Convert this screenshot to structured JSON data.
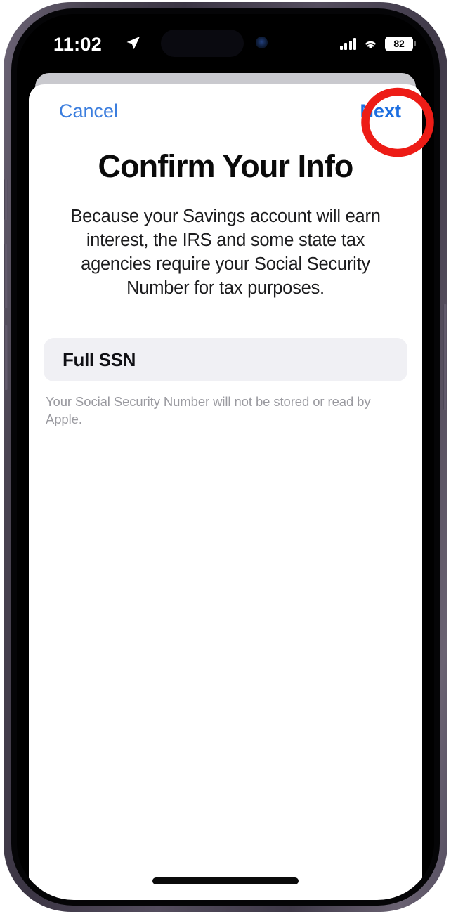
{
  "status_bar": {
    "time": "11:02",
    "location_arrow_icon": "location-arrow-icon",
    "signal_icon": "signal-bars-icon",
    "wifi_icon": "wifi-icon",
    "battery_level": "82"
  },
  "nav_bar": {
    "cancel_label": "Cancel",
    "next_label": "Next"
  },
  "screen": {
    "title": "Confirm Your Info",
    "description": "Because your Savings account will earn interest, the IRS and some state tax agencies require your Social Security Number for tax purposes.",
    "ssn_field": {
      "label": "Full SSN",
      "value": "",
      "placeholder": "Full SSN"
    },
    "helper_text": "Your Social Security Number will not be stored or read by Apple."
  },
  "annotation": {
    "target": "next-button",
    "shape": "ellipse",
    "color": "#ed1c16"
  },
  "colors": {
    "accent_blue": "#1c6ee0",
    "cancel_blue": "#3c7ede",
    "field_background": "#f0f0f4",
    "helper_text": "#9a9aa0",
    "annotation_red": "#ed1c16",
    "sheet_behind": "#c9c9ce"
  }
}
